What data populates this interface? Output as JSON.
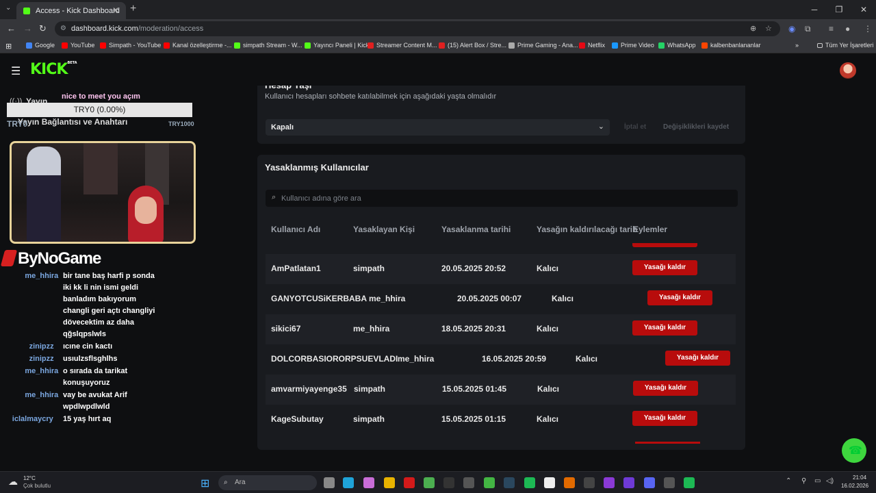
{
  "browser": {
    "tab_title": "Access - Kick Dashboard",
    "url_host": "dashboard.kick.com",
    "url_path": "/moderation/access",
    "bookmarks": [
      {
        "label": "Google",
        "color": "#4285f4"
      },
      {
        "label": "YouTube",
        "color": "#ff0000"
      },
      {
        "label": "Simpath - YouTube",
        "color": "#ff0000"
      },
      {
        "label": "Kanal özelleştirme -...",
        "color": "#ff0000"
      },
      {
        "label": "simpath Stream - W...",
        "color": "#53fc18"
      },
      {
        "label": "Yayıncı Paneli | Kick",
        "color": "#53fc18"
      },
      {
        "label": "Streamer Content M...",
        "color": "#e02020"
      },
      {
        "label": "(15) Alert Box / Stre...",
        "color": "#e02020"
      },
      {
        "label": "Prime Gaming - Ana...",
        "color": "#aaaaaa"
      },
      {
        "label": "Netflix",
        "color": "#e50914"
      },
      {
        "label": "Prime Video",
        "color": "#1a98ff"
      },
      {
        "label": "WhatsApp",
        "color": "#25d366"
      },
      {
        "label": "kalbenbanlananlar",
        "color": "#ff4500"
      }
    ],
    "all_bookmarks": "Tüm Yer İşaretleri"
  },
  "kick": {
    "logo": "KICK",
    "logo_badge": "BETA",
    "sidebar": {
      "item1": "Yayın",
      "item2": "Yayın Bağlantısı ve Anahtarı"
    },
    "account_age": {
      "title": "Hesap Yaşı",
      "description": "Kullanıcı hesapları sohbete katılabilmek için aşağıdaki yaşta olmalıdır",
      "select_value": "Kapalı",
      "cancel_label": "İptal et",
      "save_label": "Değişiklikleri kaydet"
    },
    "banned": {
      "title": "Yasaklanmış Kullanıcılar",
      "search_placeholder": "Kullanıcı adına göre ara",
      "columns": [
        "Kullanıcı Adı",
        "Yasaklayan Kişi",
        "Yasaklanma tarihi",
        "Yasağın kaldırılacağı tarih",
        "Eylemler"
      ],
      "unban_label": "Yasağı kaldır",
      "rows": [
        {
          "user": "AmPatlatan1",
          "by": "simpath",
          "date": "20.05.2025 20:52",
          "until": "Kalıcı"
        },
        {
          "user": "GANYOTCUSiKERBABA",
          "by": "me_hhira",
          "date": "20.05.2025 00:07",
          "until": "Kalıcı"
        },
        {
          "user": "sikici67",
          "by": "me_hhira",
          "date": "18.05.2025 20:31",
          "until": "Kalıcı"
        },
        {
          "user": "DOLCORBASIORORPSUEVLADI",
          "by": "me_hhira",
          "date": "16.05.2025 20:59",
          "until": "Kalıcı"
        },
        {
          "user": "amvarmiyayenge35",
          "by": "simpath",
          "date": "15.05.2025 01:45",
          "until": "Kalıcı"
        },
        {
          "user": "KageSubutay",
          "by": "simpath",
          "date": "15.05.2025 01:15",
          "until": "Kalıcı"
        }
      ]
    }
  },
  "overlay": {
    "greeting": "nice to meet you açım",
    "goal": "TRY0 (0.00%)",
    "goal_start": "TRY0",
    "goal_end": "TRY1000",
    "sponsor": "ByNoGame",
    "chat": [
      {
        "user": "me_hhira",
        "lines": [
          "bir tane baş harfi p sonda",
          "iki kk li nin ismi geldi",
          "banladım bakıyorum",
          "changli geri açtı changliyi",
          "dövecektim az daha",
          "qğslqpslwls"
        ]
      },
      {
        "user": "zinipzz",
        "lines": [
          "ıcıne cin kactı"
        ]
      },
      {
        "user": "zinipzz",
        "lines": [
          "usıulzsflsghlhs"
        ]
      },
      {
        "user": "me_hhira",
        "lines": [
          "o sırada da tarikat",
          "konuşuyoruz"
        ]
      },
      {
        "user": "me_hhira",
        "lines": [
          "vay be avukat Arif",
          "wpdlwpdlwld"
        ]
      },
      {
        "user": "iclalmaycry",
        "lines": [
          "15 yaş hırt aq"
        ]
      }
    ]
  },
  "taskbar": {
    "weather_temp": "12°C",
    "weather_desc": "Çok bulutlu",
    "search_placeholder": "Ara",
    "time": "21:04",
    "date": "16.02.2026"
  }
}
